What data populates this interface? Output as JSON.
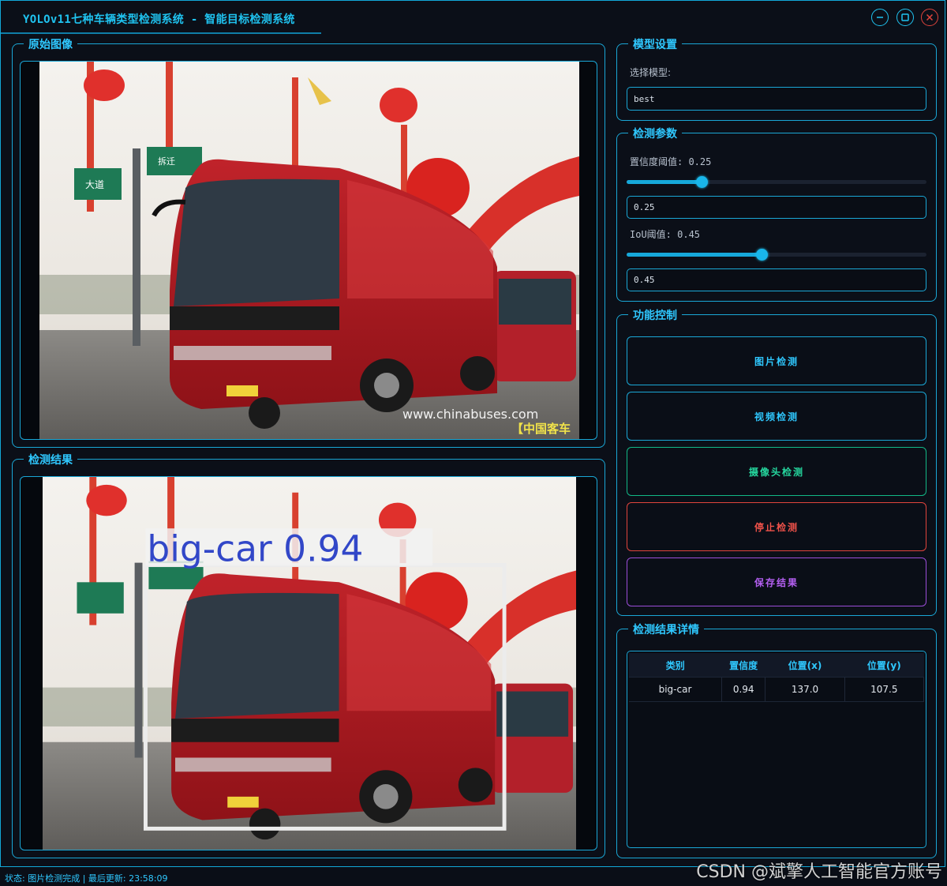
{
  "window": {
    "title": "YOLOv11七种车辆类型检测系统 - 智能目标检测系统"
  },
  "panels": {
    "original_image": "原始图像",
    "detection_result": "检测结果",
    "model_settings": "模型设置",
    "detect_params": "检测参数",
    "function_control": "功能控制",
    "result_details": "检测结果详情"
  },
  "model": {
    "select_label": "选择模型:",
    "value": "best"
  },
  "params": {
    "conf_label": "置信度阈值: 0.25",
    "conf_value": 0.25,
    "conf_input": "0.25",
    "iou_label": "IoU阈值: 0.45",
    "iou_value": 0.45,
    "iou_input": "0.45"
  },
  "buttons": {
    "image_detect": "图片检测",
    "video_detect": "视频检测",
    "camera_detect": "摄像头检测",
    "stop_detect": "停止检测",
    "save_result": "保存结果"
  },
  "colors": {
    "accent": "#1aa7d6",
    "image_btn": "#1aa7d6",
    "video_btn": "#1aa7d6",
    "camera_btn": "#12b886",
    "stop_btn": "#e0443c",
    "save_btn": "#9b4dd8"
  },
  "table": {
    "headers": [
      "类别",
      "置信度",
      "位置(x)",
      "位置(y)"
    ],
    "rows": [
      [
        "big-car",
        "0.94",
        "137.0",
        "107.5"
      ]
    ]
  },
  "detection": {
    "label": "big-car 0.94"
  },
  "image_text": {
    "sign_left": "大道",
    "sign_right": "拆迁",
    "watermark": "www.chinabuses.com",
    "cn_tag": "【中国客车"
  },
  "status": {
    "text": "状态: 图片检测完成 | 最后更新: 23:58:09"
  },
  "overlay_watermark": "CSDN @斌擎人工智能官方账号",
  "icons": {
    "minimize": "minimize-icon",
    "maximize": "maximize-icon",
    "close": "close-icon"
  }
}
